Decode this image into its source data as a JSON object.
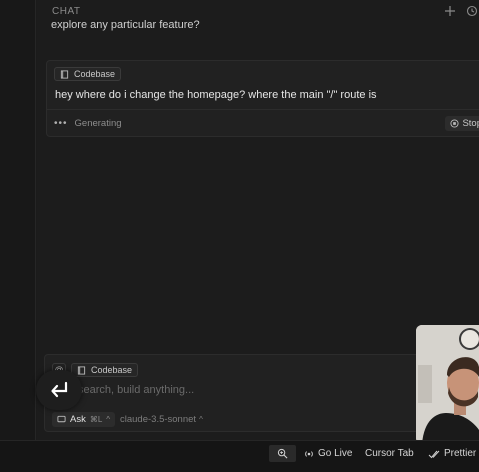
{
  "chat": {
    "header_title": "CHAT",
    "previous_text": "explore any particular feature?",
    "message": {
      "context_chip": "Codebase",
      "text": "hey where do i change the homepage? where the main \"/\" route is",
      "status": "Generating",
      "stop_label": "Stop"
    }
  },
  "composer": {
    "at_symbol": "@",
    "context_chip": "Codebase",
    "placeholder": "search, build anything...",
    "mode_label": "Ask",
    "mode_shortcut": "⌘L",
    "model": "claude-3.5-sonnet"
  },
  "status_bar": {
    "go_live": "Go Live",
    "cursor_tab": "Cursor Tab",
    "prettier": "Prettier"
  },
  "icons": {
    "add": "plus-icon",
    "history": "history-icon",
    "codebase": "book-icon",
    "enter": "return-icon",
    "zoom": "zoom-icon",
    "broadcast": "broadcast-icon",
    "prettier": "check-double-icon"
  }
}
